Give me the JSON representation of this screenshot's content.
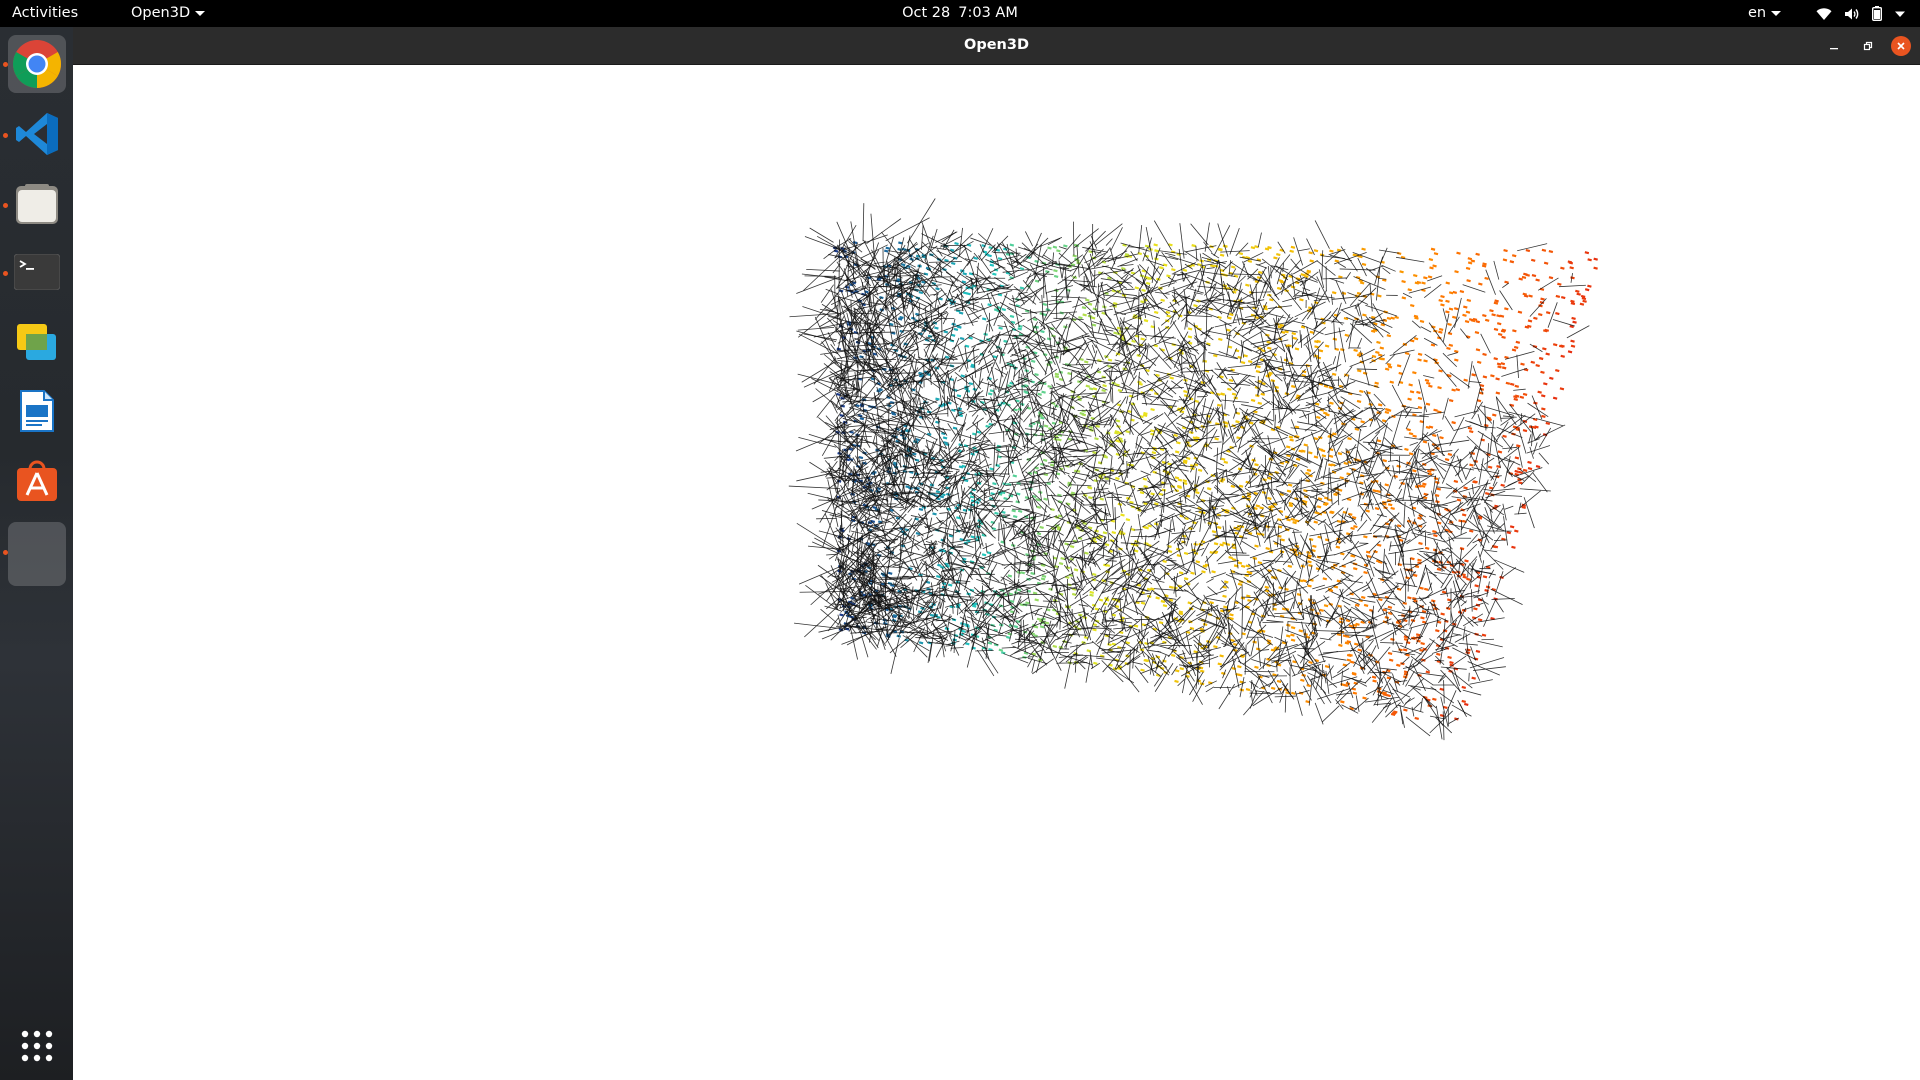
{
  "topbar": {
    "activities": "Activities",
    "app_menu": "Open3D",
    "date": "Oct 28",
    "time": "7:03 AM",
    "language": "en",
    "icons": [
      "wifi-icon",
      "volume-icon",
      "battery-icon",
      "system-menu-icon"
    ]
  },
  "dock": {
    "items": [
      {
        "name": "chrome",
        "icon": "chrome-icon",
        "running": true
      },
      {
        "name": "vscode",
        "icon": "vscode-icon",
        "running": true
      },
      {
        "name": "files",
        "icon": "files-icon",
        "running": true
      },
      {
        "name": "terminal",
        "icon": "terminal-icon",
        "running": true
      },
      {
        "name": "slides",
        "icon": "slides-icon",
        "running": false
      },
      {
        "name": "writer",
        "icon": "writer-icon",
        "running": false
      },
      {
        "name": "software",
        "icon": "app-store-icon",
        "running": false
      },
      {
        "name": "open3d",
        "icon": "open3d-window-icon",
        "running": true
      }
    ],
    "show_apps_icon": "grid-icon"
  },
  "window": {
    "title": "Open3D",
    "controls": [
      "minimize-icon",
      "maximize-icon",
      "close-icon"
    ],
    "accent": "#e95420"
  },
  "viewport": {
    "content": "point-cloud-with-normals",
    "background": "#ffffff",
    "colormap": [
      "#1a3a8a",
      "#1fc7c2",
      "#e8e620",
      "#f5b800",
      "#ff7a00",
      "#e52a10"
    ]
  }
}
